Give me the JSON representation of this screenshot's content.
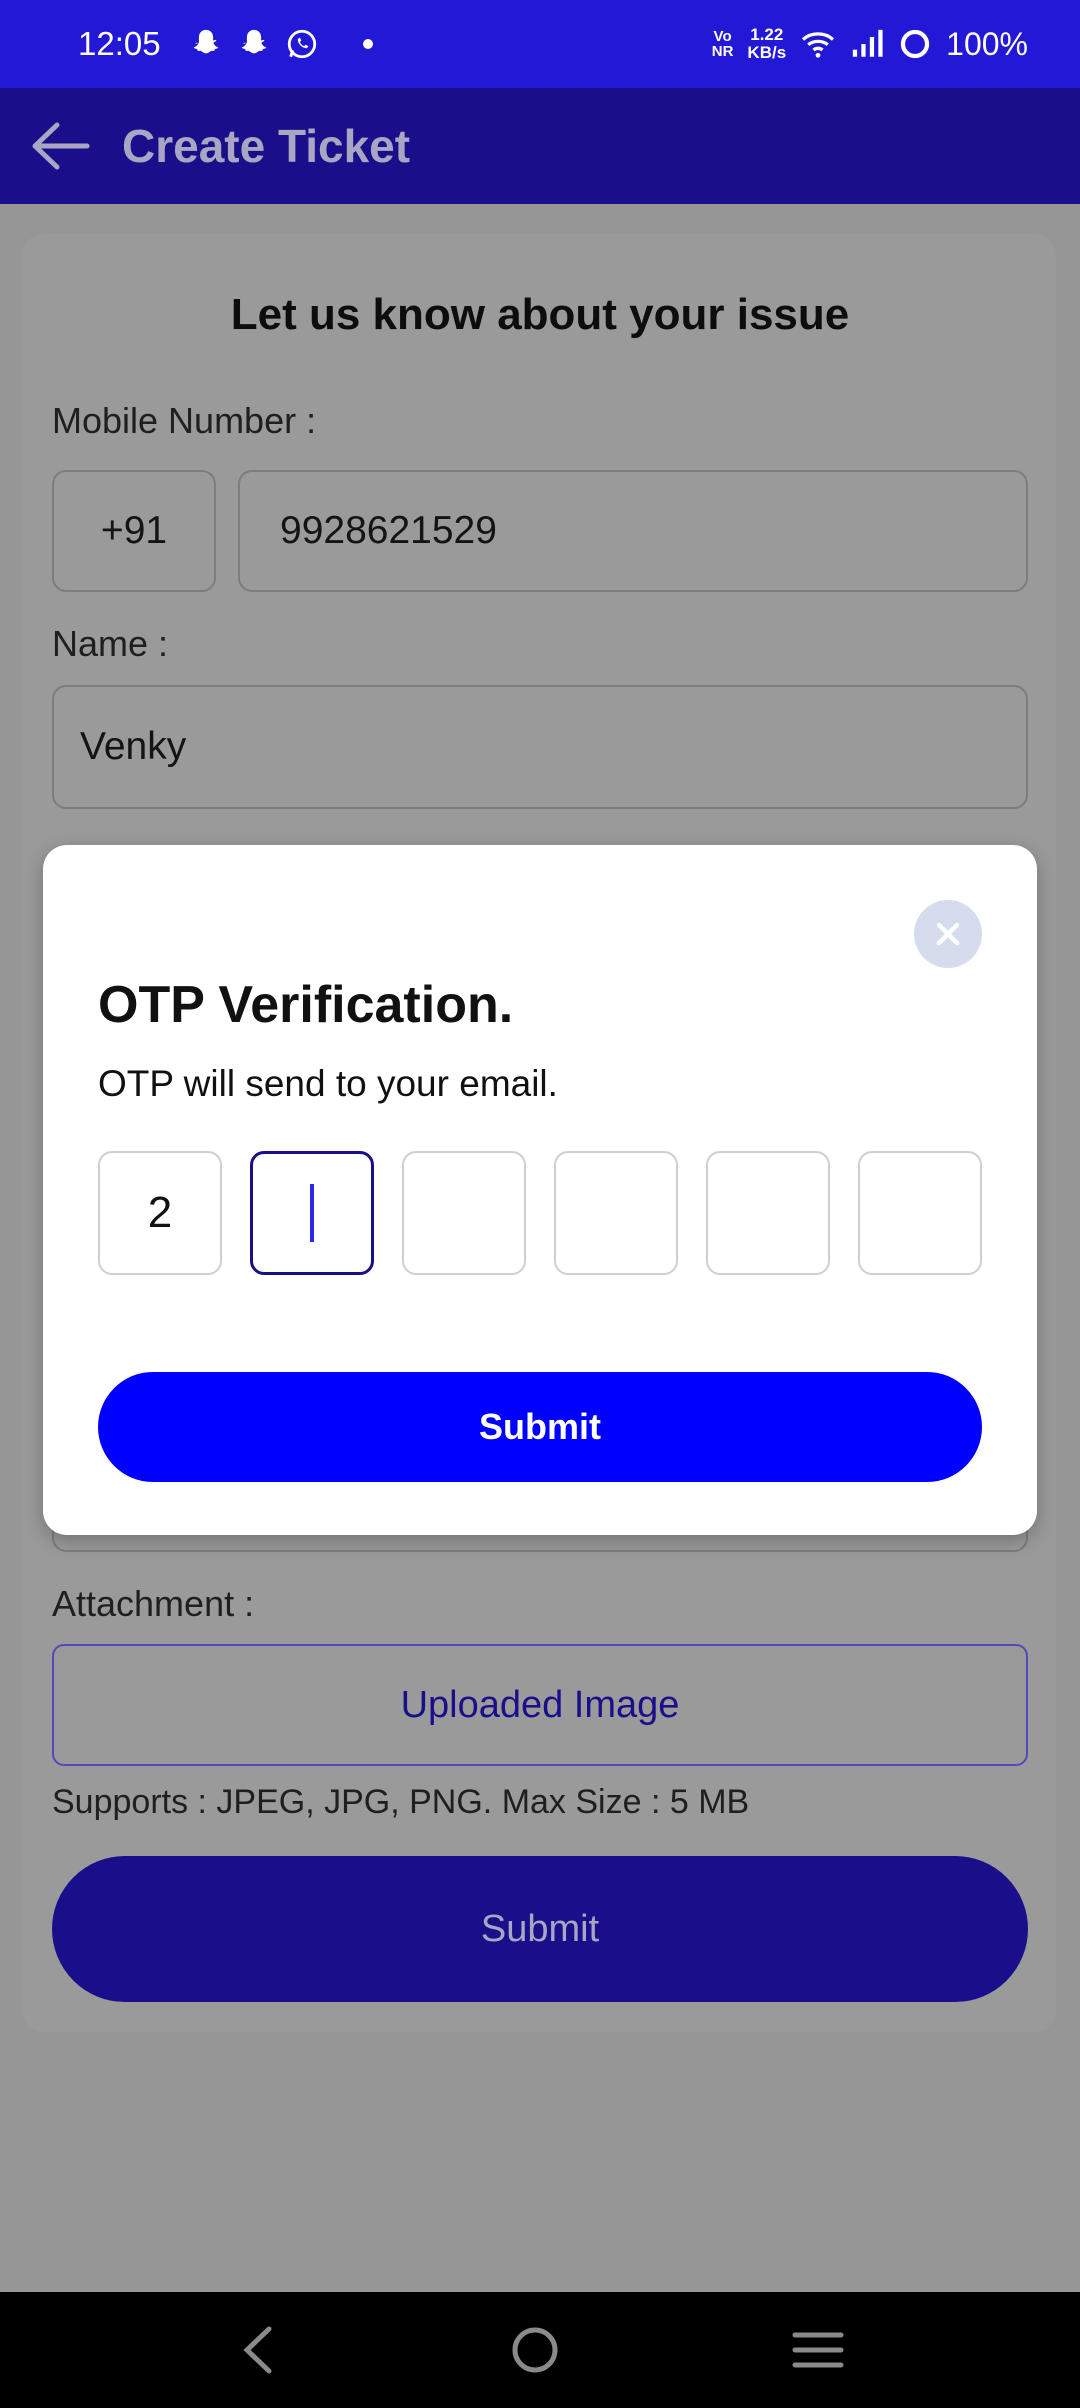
{
  "status_bar": {
    "time": "12:05",
    "network_type_top": "Vo",
    "network_type_bottom": "NR",
    "speed_value": "1.22",
    "speed_unit": "KB/s",
    "battery": "100%"
  },
  "app_bar": {
    "title": "Create Ticket"
  },
  "form": {
    "heading": "Let us know about your issue",
    "mobile_label": "Mobile Number :",
    "country_code": "+91",
    "mobile_value": "9928621529",
    "name_label": "Name :",
    "name_value": "Venky",
    "attachment_label": "Attachment :",
    "upload_label": "Uploaded Image",
    "supports_text": "Supports : JPEG, JPG, PNG. Max Size : 5 MB",
    "submit_label": "Submit"
  },
  "modal": {
    "title": "OTP Verification.",
    "subtitle": "OTP will send to your email.",
    "digits": [
      "2",
      "",
      "",
      "",
      "",
      ""
    ],
    "submit_label": "Submit"
  },
  "colors": {
    "status_bar": "#2318d6",
    "app_bar": "#1a0f8a",
    "modal_submit": "#0000ff",
    "overlay_bg": "#969696"
  }
}
